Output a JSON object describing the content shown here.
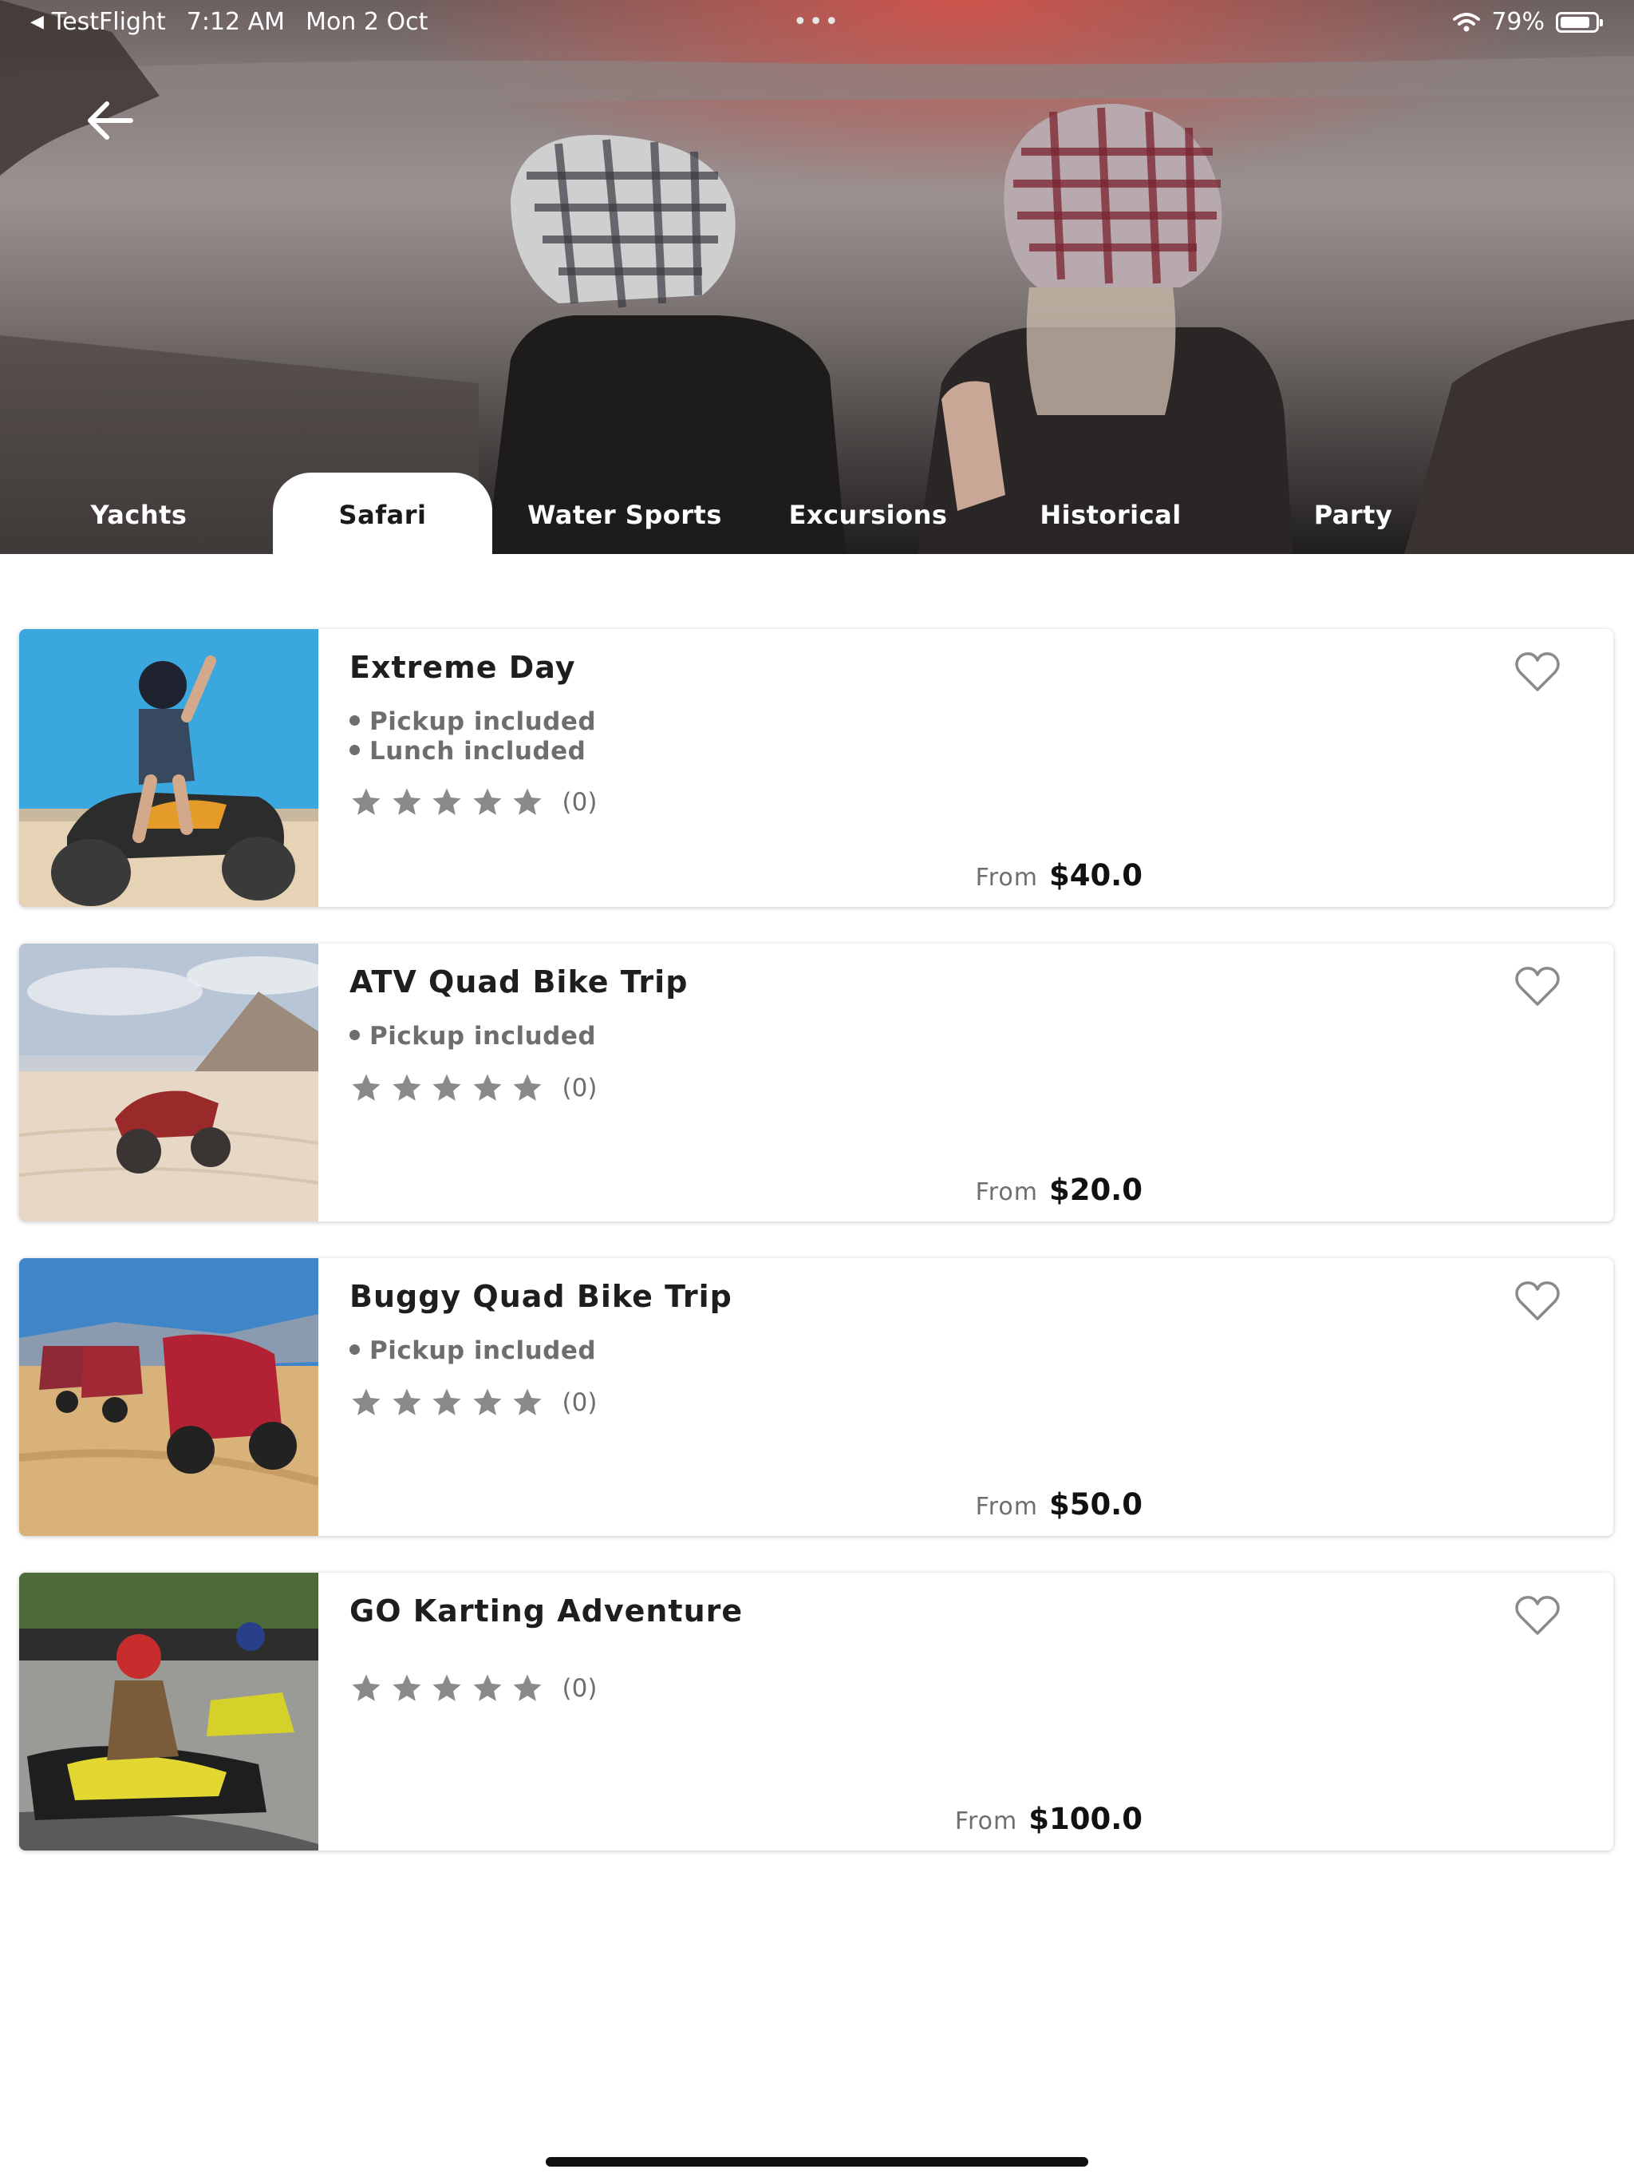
{
  "status_bar": {
    "app": "TestFlight",
    "time": "7:12 AM",
    "date": "Mon 2 Oct",
    "battery": "79%",
    "battery_level": 0.79
  },
  "tabs": [
    {
      "label": "Yachts",
      "active": false
    },
    {
      "label": "Safari",
      "active": true
    },
    {
      "label": "Water Sports",
      "active": false
    },
    {
      "label": "Excursions",
      "active": false
    },
    {
      "label": "Historical",
      "active": false
    },
    {
      "label": "Party",
      "active": false
    }
  ],
  "listings": [
    {
      "title": "Extreme Day",
      "features": [
        "Pickup included",
        "Lunch included"
      ],
      "rating": 0,
      "reviews": "(0)",
      "from_label": "From",
      "price": "$40.0",
      "image": "quad-bike-rider-photo"
    },
    {
      "title": "ATV Quad Bike Trip",
      "features": [
        "Pickup included"
      ],
      "rating": 0,
      "reviews": "(0)",
      "from_label": "From",
      "price": "$20.0",
      "image": "atv-desert-photo"
    },
    {
      "title": "Buggy Quad Bike Trip",
      "features": [
        "Pickup included"
      ],
      "rating": 0,
      "reviews": "(0)",
      "from_label": "From",
      "price": "$50.0",
      "image": "buggies-desert-photo"
    },
    {
      "title": "GO Karting Adventure",
      "features": [],
      "rating": 0,
      "reviews": "(0)",
      "from_label": "From",
      "price": "$100.0",
      "image": "go-kart-photo"
    }
  ],
  "colors": {
    "active_tab_bg": "#ffffff",
    "tab_text": "#ffffff",
    "star": "#8a8a8a",
    "heart": "#8a8a8a"
  }
}
